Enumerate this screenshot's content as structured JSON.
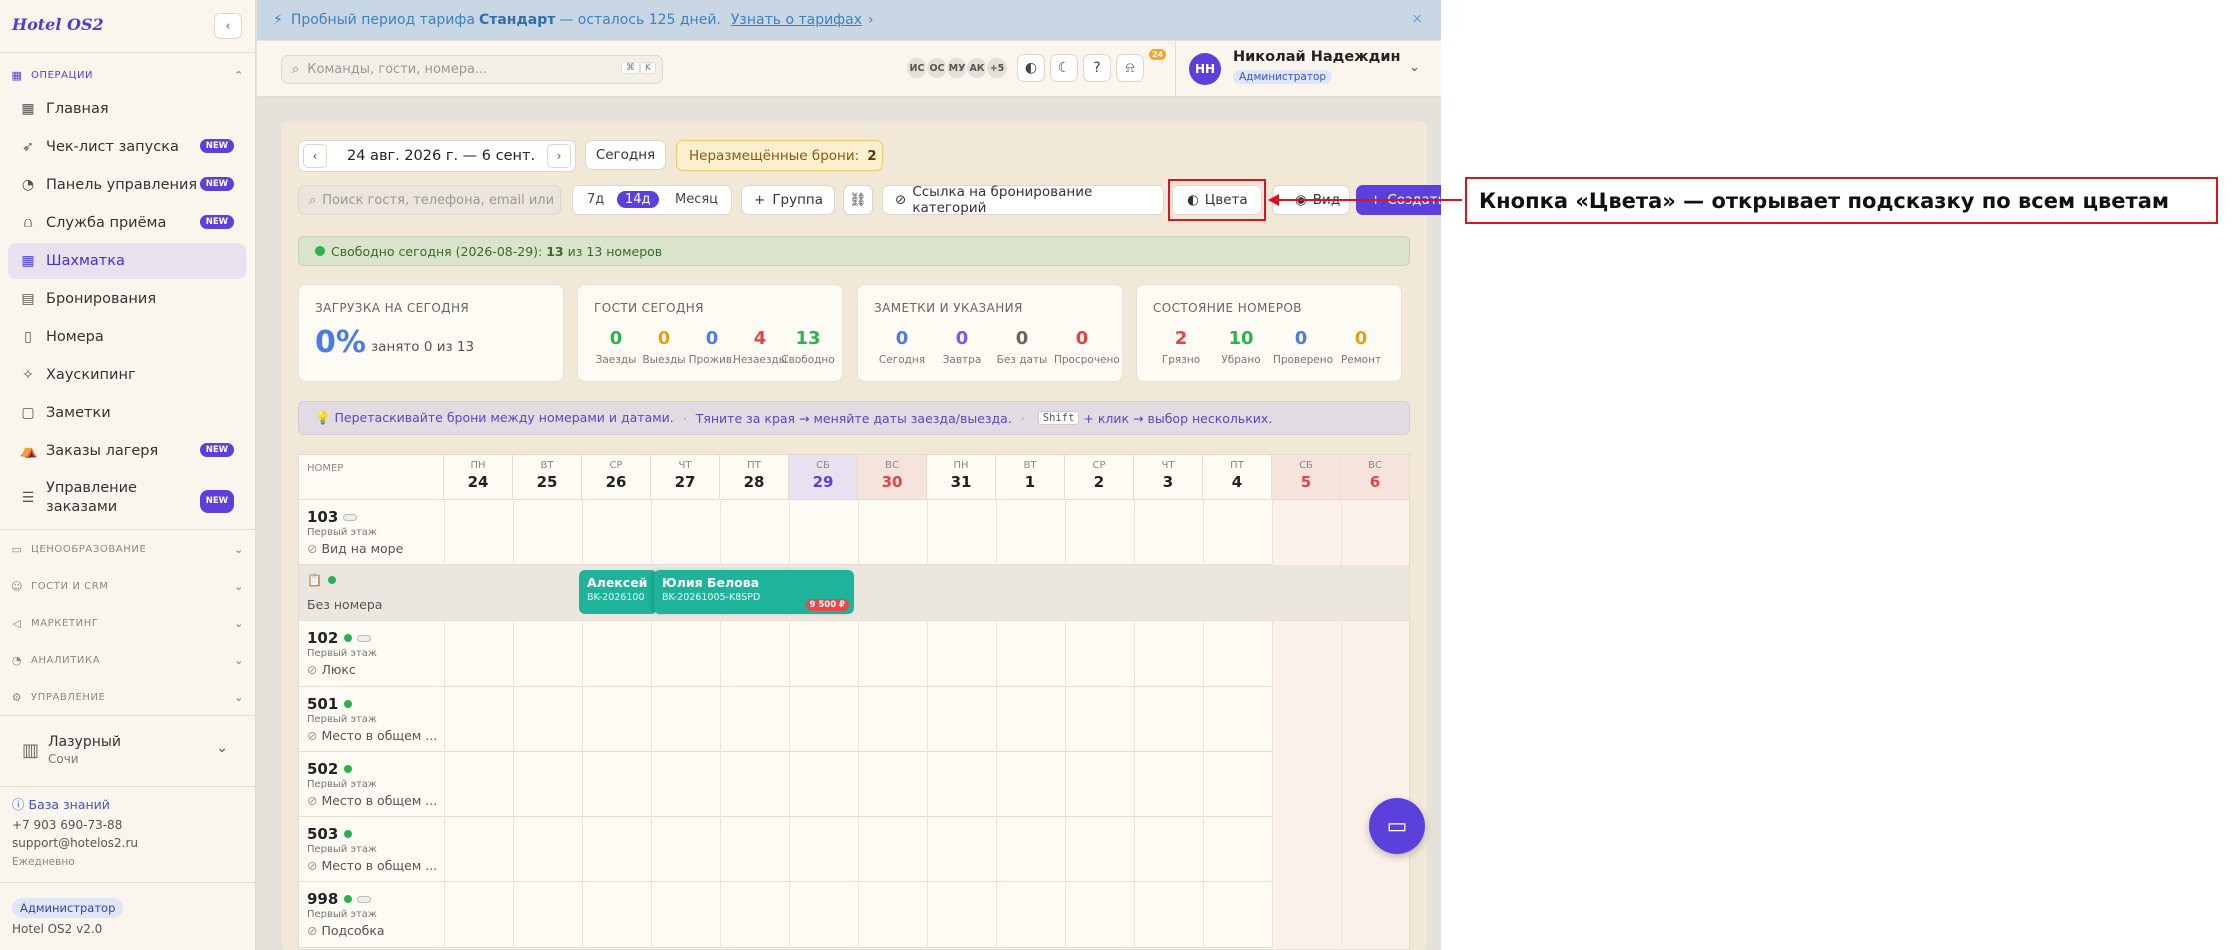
{
  "sidebar": {
    "logo": "Hotel OS2",
    "sections": {
      "operations": "ОПЕРАЦИИ",
      "pricing": "ЦЕНООБРАЗОВАНИЕ",
      "guests": "ГОСТИ И CRM",
      "marketing": "МАРКЕТИНГ",
      "analytics": "АНАЛИТИКА",
      "management": "УПРАВЛЕНИЕ"
    },
    "items": [
      {
        "label": "Главная",
        "icon": "dashboard-grid-icon"
      },
      {
        "label": "Чек-лист запуска",
        "icon": "rocket-icon",
        "badge": "NEW"
      },
      {
        "label": "Панель управления",
        "icon": "gauge-icon",
        "badge": "NEW"
      },
      {
        "label": "Служба приёма",
        "icon": "bell-icon",
        "badge": "NEW"
      },
      {
        "label": "Шахматка",
        "icon": "grid-icon"
      },
      {
        "label": "Бронирования",
        "icon": "clipboard-icon"
      },
      {
        "label": "Номера",
        "icon": "door-icon"
      },
      {
        "label": "Хаускипинг",
        "icon": "sparkle-icon"
      },
      {
        "label": "Заметки",
        "icon": "note-icon"
      },
      {
        "label": "Заказы лагеря",
        "icon": "tent-icon",
        "badge": "NEW"
      },
      {
        "label": "Управление заказами",
        "icon": "list-icon",
        "badge": "NEW"
      }
    ],
    "hotel": {
      "name": "Лазурный",
      "city": "Сочи"
    },
    "footer": {
      "knowledge": "База знаний",
      "phone": "+7 903 690-73-88",
      "email": "support@hotelos2.ru",
      "hours": "Ежедневно",
      "role": "Администратор",
      "version": "Hotel OS2 v2.0"
    }
  },
  "banner": {
    "prefix": "Пробный период тарифа",
    "plan": "Стандарт",
    "suffix": "— осталось 125 дней.",
    "link": "Узнать о тарифах",
    "chevron": "›",
    "close": "×"
  },
  "topbar": {
    "search_placeholder": "Команды, гости, номера...",
    "kbd1": "⌘",
    "kbd2": "K",
    "avatars": [
      "ИС",
      "ОС",
      "МУ",
      "АК",
      "+5"
    ],
    "notif_count": "24",
    "user_initials": "НН",
    "user_name": "Николай Надеждин",
    "user_role": "Администратор"
  },
  "toolbar": {
    "date_range": "24 авг. 2026 г. — 6 сент.",
    "today": "Сегодня",
    "unplaced_label": "Неразмещённые брони:",
    "unplaced_count": "2",
    "search_placeholder": "Поиск гостя, телефона, email или",
    "view_7": "7д",
    "view_14": "14д",
    "view_month": "Месяц",
    "group": "Группа",
    "link_booking": "Ссылка на бронирование категорий",
    "colors": "Цвета",
    "view": "Вид",
    "create": "Создать"
  },
  "free_strip": {
    "text": "Свободно сегодня (2026-08-29):",
    "count": "13",
    "tail": "из 13 номеров"
  },
  "stats": {
    "load": {
      "title": "ЗАГРУЗКА НА СЕГОДНЯ",
      "value": "0%",
      "sub": "занято 0 из 13"
    },
    "guests": {
      "title": "ГОСТИ СЕГОДНЯ",
      "metrics": [
        {
          "v": "0",
          "l": "Заезды",
          "color": "#2bb24c"
        },
        {
          "v": "0",
          "l": "Выезды",
          "color": "#e0a21a"
        },
        {
          "v": "0",
          "l": "Прожив.",
          "color": "#4a7ce6"
        },
        {
          "v": "4",
          "l": "Незаезды",
          "color": "#e04444"
        },
        {
          "v": "13",
          "l": "Свободно",
          "color": "#2bb24c"
        }
      ]
    },
    "notes": {
      "title": "ЗАМЕТКИ И УКАЗАНИЯ",
      "metrics": [
        {
          "v": "0",
          "l": "Сегодня",
          "color": "#4a7ce6"
        },
        {
          "v": "0",
          "l": "Завтра",
          "color": "#7b5be6"
        },
        {
          "v": "0",
          "l": "Без даты",
          "color": "#666666"
        },
        {
          "v": "0",
          "l": "Просрочено",
          "color": "#e04444"
        }
      ]
    },
    "rooms": {
      "title": "СОСТОЯНИЕ НОМЕРОВ",
      "metrics": [
        {
          "v": "2",
          "l": "Грязно",
          "color": "#e04444"
        },
        {
          "v": "10",
          "l": "Убрано",
          "color": "#2bb24c"
        },
        {
          "v": "0",
          "l": "Проверено",
          "color": "#4a7ce6"
        },
        {
          "v": "0",
          "l": "Ремонт",
          "color": "#e0a21a"
        }
      ]
    }
  },
  "hint": {
    "part1": "💡 Перетаскивайте брони между номерами и датами.",
    "sep": "·",
    "part2": "Тяните за края → меняйте даты заезда/выезда.",
    "kbd": "Shift",
    "part3": "+ клик → выбор нескольких."
  },
  "grid": {
    "header": "НОМЕР",
    "days": [
      {
        "dw": "ПН",
        "dn": "24"
      },
      {
        "dw": "ВТ",
        "dn": "25"
      },
      {
        "dw": "СР",
        "dn": "26"
      },
      {
        "dw": "ЧТ",
        "dn": "27"
      },
      {
        "dw": "ПТ",
        "dn": "28"
      },
      {
        "dw": "СБ",
        "dn": "29"
      },
      {
        "dw": "ВС",
        "dn": "30"
      },
      {
        "dw": "ПН",
        "dn": "31"
      },
      {
        "dw": "ВТ",
        "dn": "1"
      },
      {
        "dw": "СР",
        "dn": "2"
      },
      {
        "dw": "ЧТ",
        "dn": "3"
      },
      {
        "dw": "ПТ",
        "dn": "4"
      },
      {
        "dw": "СБ",
        "dn": "5"
      },
      {
        "dw": "ВС",
        "dn": "6"
      }
    ],
    "rows": [
      {
        "num": "103",
        "floor": "Первый этаж",
        "cat": "Вид на море"
      },
      {
        "num": "",
        "floor": "",
        "cat": "Без номера"
      },
      {
        "num": "102",
        "floor": "Первый этаж",
        "cat": "Люкс"
      },
      {
        "num": "501",
        "floor": "Первый этаж",
        "cat": "Место в общем ..."
      },
      {
        "num": "502",
        "floor": "Первый этаж",
        "cat": "Место в общем ..."
      },
      {
        "num": "503",
        "floor": "Первый этаж",
        "cat": "Место в общем ..."
      },
      {
        "num": "998",
        "floor": "Первый этаж",
        "cat": "Подсобка"
      }
    ],
    "bookings": [
      {
        "name": "Алексей",
        "code": "BK-2026100"
      },
      {
        "name": "Юлия Белова",
        "code": "BK-20261005-K8SPD",
        "price": "9 500 ₽"
      }
    ]
  },
  "annotation": {
    "text": "Кнопка «Цвета» — открывает подсказку по всем цветам"
  },
  "colors": {
    "accent": "#5b40dc",
    "annotation": "#d9141e",
    "booking": "#1fb39a"
  }
}
